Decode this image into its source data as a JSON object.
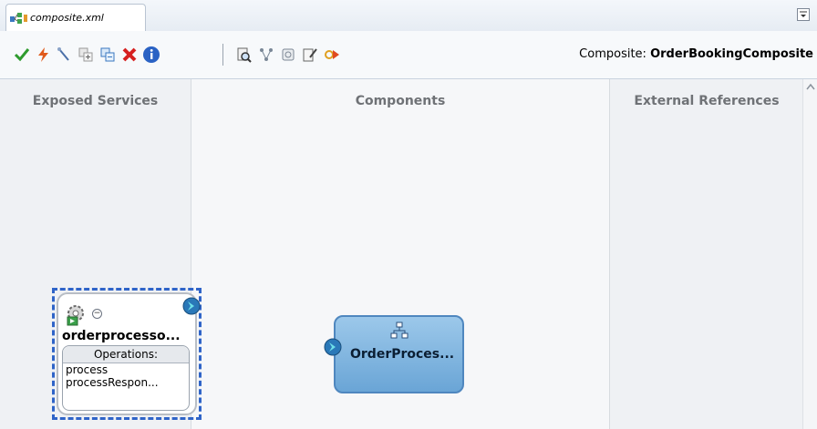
{
  "editor": {
    "tab_label": "composite.xml"
  },
  "toolbar": {
    "composite_label": "Composite:",
    "composite_name": "OrderBookingComposite"
  },
  "canvas": {
    "exposed_services_header": "Exposed Services",
    "components_header": "Components",
    "external_references_header": "External References"
  },
  "service": {
    "name": "orderprocesso...",
    "operations_header": "Operations:",
    "operations": [
      "process",
      "processRespon..."
    ]
  },
  "component": {
    "name": "OrderProces..."
  },
  "colors": {
    "selection_dash": "#2f64c8",
    "component_fill": "#6aa5d6",
    "validate_green": "#2e9b2e",
    "delete_red": "#d62020"
  }
}
